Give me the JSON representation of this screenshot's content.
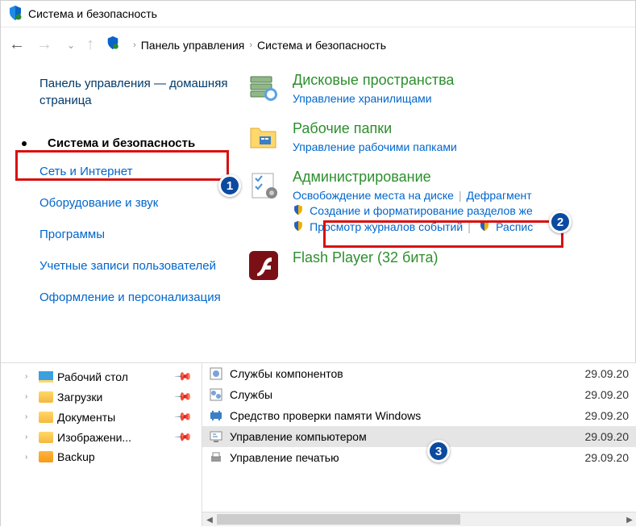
{
  "title": "Система и безопасность",
  "breadcrumb": {
    "control_panel": "Панель управления",
    "category": "Система и безопасность"
  },
  "sidebar": {
    "home": "Панель управления — домашняя страница",
    "current": "Система и безопасность",
    "items": [
      "Сеть и Интернет",
      "Оборудование и звук",
      "Программы",
      "Учетные записи пользователей",
      "Оформление и персонализация"
    ]
  },
  "cp": {
    "storage": {
      "title": "Дисковые пространства",
      "sub": "Управление хранилищами"
    },
    "workfolders": {
      "title": "Рабочие папки",
      "sub": "Управление рабочими папками"
    },
    "admin": {
      "title": "Администрирование",
      "s1": "Освобождение места на диске",
      "s2": "Дефрагмент",
      "s3": "Создание и форматирование разделов же",
      "s4": "Просмотр журналов событий",
      "s5": "Распис"
    },
    "flash": {
      "title": "Flash Player (32 бита)"
    }
  },
  "tree": {
    "desktop": "Рабочий стол",
    "downloads": "Загрузки",
    "documents": "Документы",
    "images": "Изображени...",
    "backup": "Backup"
  },
  "files": [
    {
      "name": "Службы компонентов",
      "date": "29.09.20"
    },
    {
      "name": "Службы",
      "date": "29.09.20"
    },
    {
      "name": "Средство проверки памяти Windows",
      "date": "29.09.20"
    },
    {
      "name": "Управление компьютером",
      "date": "29.09.20"
    },
    {
      "name": "Управление печатью",
      "date": "29.09.20"
    }
  ],
  "badges": {
    "one": "1",
    "two": "2",
    "three": "3"
  }
}
